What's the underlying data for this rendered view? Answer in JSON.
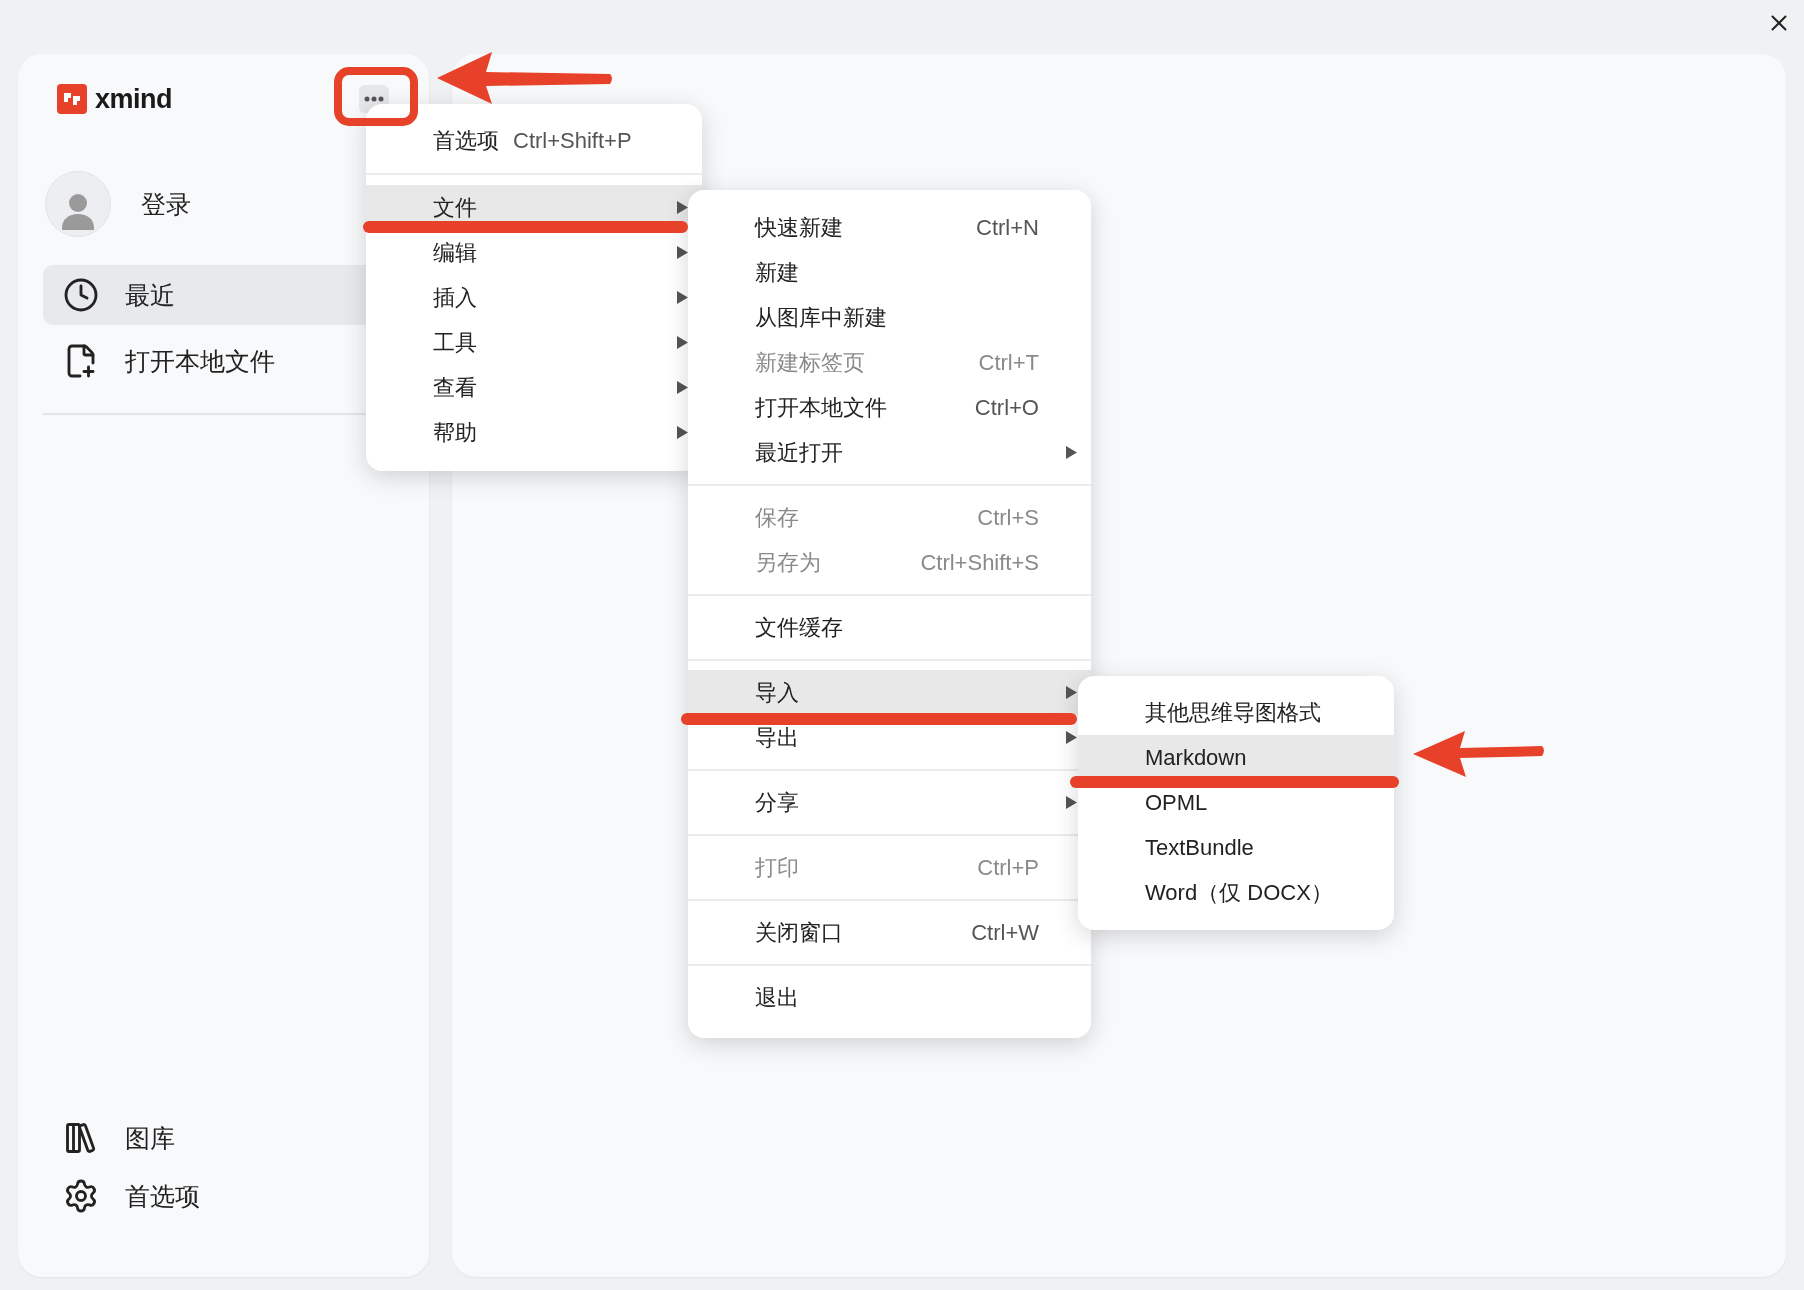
{
  "app": {
    "logo": "xmind"
  },
  "sidebar": {
    "user": {
      "label": "登录"
    },
    "nav": [
      {
        "label": "最近",
        "selected": true
      },
      {
        "label": "打开本地文件",
        "selected": false
      }
    ],
    "footer": [
      {
        "label": "图库"
      },
      {
        "label": "首选项"
      }
    ]
  },
  "main_menu": [
    {
      "kind": "item",
      "label": "首选项",
      "shortcut": "Ctrl+Shift+P",
      "submenu": false,
      "selected": false
    },
    {
      "kind": "separator"
    },
    {
      "kind": "item",
      "label": "文件",
      "submenu": true,
      "selected": true
    },
    {
      "kind": "item",
      "label": "编辑",
      "submenu": true,
      "selected": false
    },
    {
      "kind": "item",
      "label": "插入",
      "submenu": true,
      "selected": false
    },
    {
      "kind": "item",
      "label": "工具",
      "submenu": true,
      "selected": false
    },
    {
      "kind": "item",
      "label": "查看",
      "submenu": true,
      "selected": false
    },
    {
      "kind": "item",
      "label": "帮助",
      "submenu": true,
      "selected": false
    }
  ],
  "file_menu": [
    {
      "kind": "item",
      "label": "快速新建",
      "shortcut": "Ctrl+N",
      "submenu": false,
      "disabled": false,
      "selected": false
    },
    {
      "kind": "item",
      "label": "新建",
      "submenu": false,
      "disabled": false,
      "selected": false
    },
    {
      "kind": "item",
      "label": "从图库中新建",
      "submenu": false,
      "disabled": false,
      "selected": false
    },
    {
      "kind": "item",
      "label": "新建标签页",
      "shortcut": "Ctrl+T",
      "submenu": false,
      "disabled": true,
      "selected": false
    },
    {
      "kind": "item",
      "label": "打开本地文件",
      "shortcut": "Ctrl+O",
      "submenu": false,
      "disabled": false,
      "selected": false
    },
    {
      "kind": "item",
      "label": "最近打开",
      "submenu": true,
      "disabled": false,
      "selected": false
    },
    {
      "kind": "separator"
    },
    {
      "kind": "item",
      "label": "保存",
      "shortcut": "Ctrl+S",
      "submenu": false,
      "disabled": true,
      "selected": false
    },
    {
      "kind": "item",
      "label": "另存为",
      "shortcut": "Ctrl+Shift+S",
      "submenu": false,
      "disabled": true,
      "selected": false
    },
    {
      "kind": "separator"
    },
    {
      "kind": "item",
      "label": "文件缓存",
      "submenu": false,
      "disabled": false,
      "selected": false
    },
    {
      "kind": "separator"
    },
    {
      "kind": "item",
      "label": "导入",
      "submenu": true,
      "disabled": false,
      "selected": true
    },
    {
      "kind": "item",
      "label": "导出",
      "submenu": true,
      "disabled": false,
      "selected": false
    },
    {
      "kind": "separator"
    },
    {
      "kind": "item",
      "label": "分享",
      "submenu": true,
      "disabled": false,
      "selected": false
    },
    {
      "kind": "separator"
    },
    {
      "kind": "item",
      "label": "打印",
      "shortcut": "Ctrl+P",
      "submenu": false,
      "disabled": true,
      "selected": false
    },
    {
      "kind": "separator"
    },
    {
      "kind": "item",
      "label": "关闭窗口",
      "shortcut": "Ctrl+W",
      "submenu": false,
      "disabled": false,
      "selected": false
    },
    {
      "kind": "separator"
    },
    {
      "kind": "item",
      "label": "退出",
      "submenu": false,
      "disabled": false,
      "selected": false
    }
  ],
  "import_menu": [
    {
      "kind": "item",
      "label": "其他思维导图格式",
      "selected": false
    },
    {
      "kind": "item",
      "label": "Markdown",
      "selected": true
    },
    {
      "kind": "item",
      "label": "OPML",
      "selected": false
    },
    {
      "kind": "item",
      "label": "TextBundle",
      "selected": false
    },
    {
      "kind": "item",
      "label": "Word（仅 DOCX）",
      "selected": false
    }
  ]
}
